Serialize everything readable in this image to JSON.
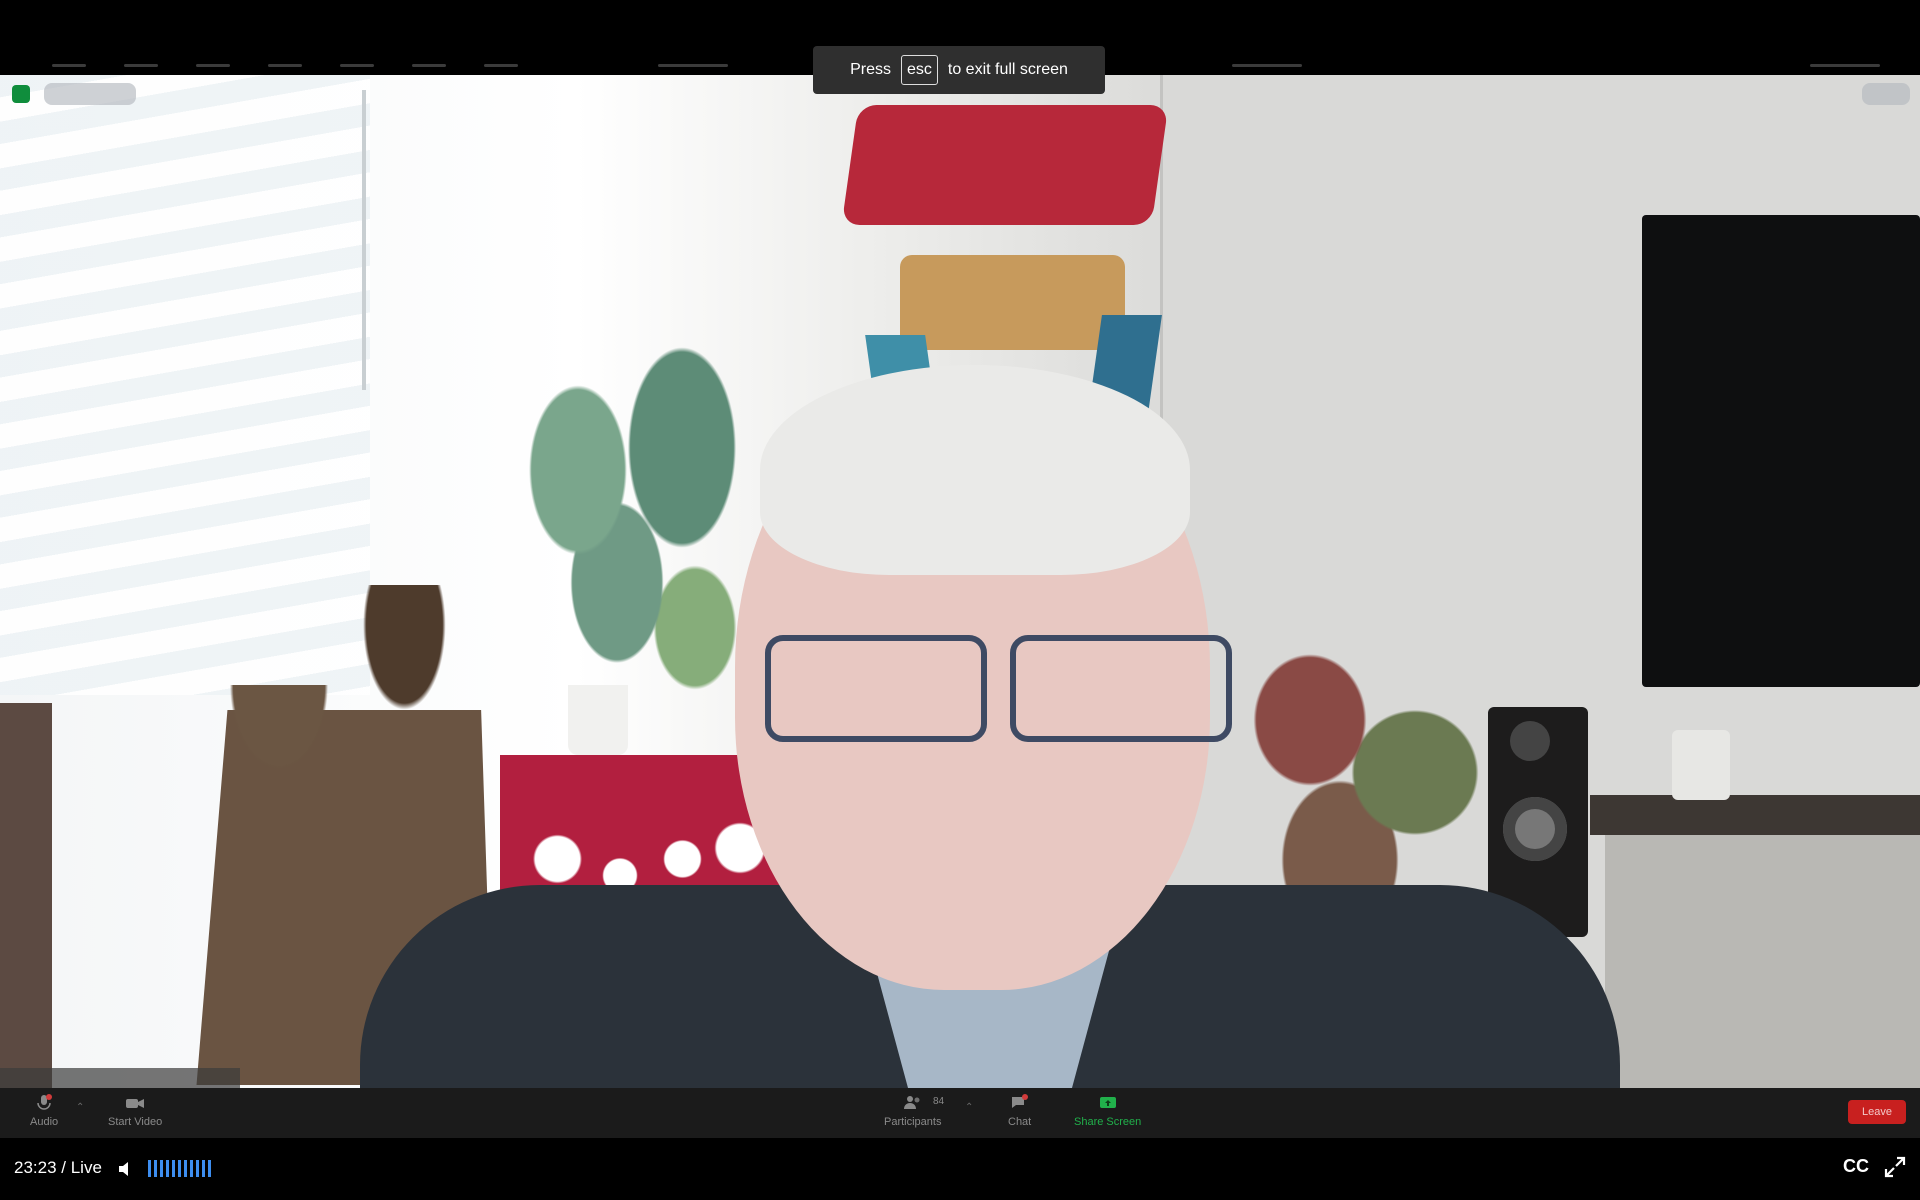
{
  "fullscreen_banner": {
    "press": "Press",
    "key": "esc",
    "message": "to exit full screen"
  },
  "zoom_toolbar": {
    "audio_label": "Audio",
    "video_label": "Start Video",
    "participants_label": "Participants",
    "participants_count": "84",
    "chat_label": "Chat",
    "share_label": "Share Screen",
    "leave_label": "Leave",
    "share_color": "#21b04b",
    "leave_color": "#c8201f"
  },
  "player": {
    "time": "23:23 / Live",
    "cc_label": "CC",
    "volume_icon": "speaker-icon",
    "fullscreen_icon": "expand-icon",
    "accent": "#3d8ef0"
  }
}
